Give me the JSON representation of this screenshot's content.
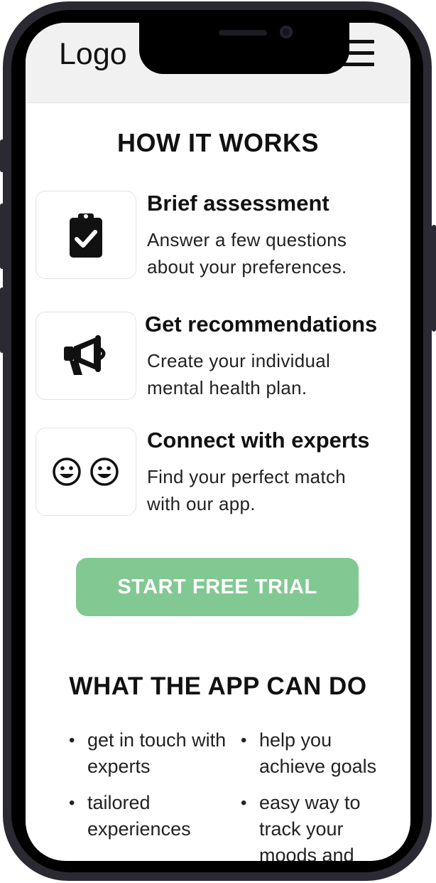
{
  "header": {
    "logo": "Logo",
    "menu_icon": "hamburger-menu-icon"
  },
  "how_it_works": {
    "title": "HOW IT WORKS",
    "steps": [
      {
        "icon": "clipboard-check-icon",
        "title": "Brief assessment",
        "description": "Answer a few questions about your preferences."
      },
      {
        "icon": "megaphone-icon",
        "title": "Get recommendations",
        "description": "Create your individual mental health plan."
      },
      {
        "icon": "smiley-faces-icon",
        "title": "Connect with experts",
        "description": "Find your perfect match with our app."
      }
    ]
  },
  "cta": {
    "label": "START FREE TRIAL",
    "color": "#82c893"
  },
  "features": {
    "title": "WHAT THE APP CAN DO",
    "items": [
      "get in touch with experts",
      "help you achieve goals",
      "tailored experiences",
      "easy way to track your moods and"
    ]
  }
}
